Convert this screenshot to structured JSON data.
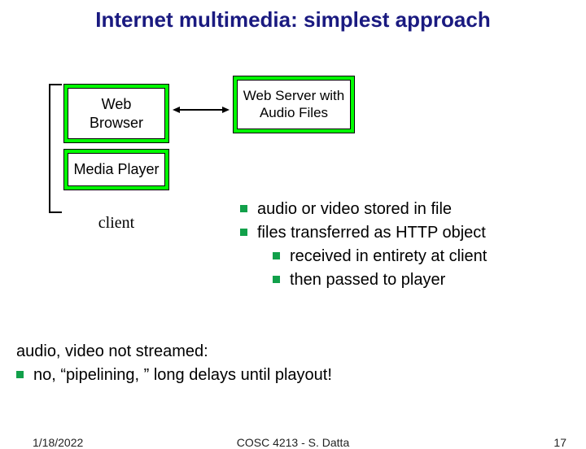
{
  "title": "Internet multimedia: simplest approach",
  "diagram": {
    "box1": "Web Browser",
    "box2": "Media Player",
    "box3": "Web Server with Audio Files",
    "client_label": "client"
  },
  "bullets": {
    "b1": "audio or video stored in file",
    "b2": "files transferred as HTTP object",
    "b2a": "received in entirety at client",
    "b2b": "then passed to player"
  },
  "conclusion": {
    "line1": "audio, video not streamed:",
    "line2": "no, “pipelining, ” long delays until playout!"
  },
  "footer": {
    "date": "1/18/2022",
    "course": "COSC 4213 - S. Datta",
    "page": "17"
  }
}
